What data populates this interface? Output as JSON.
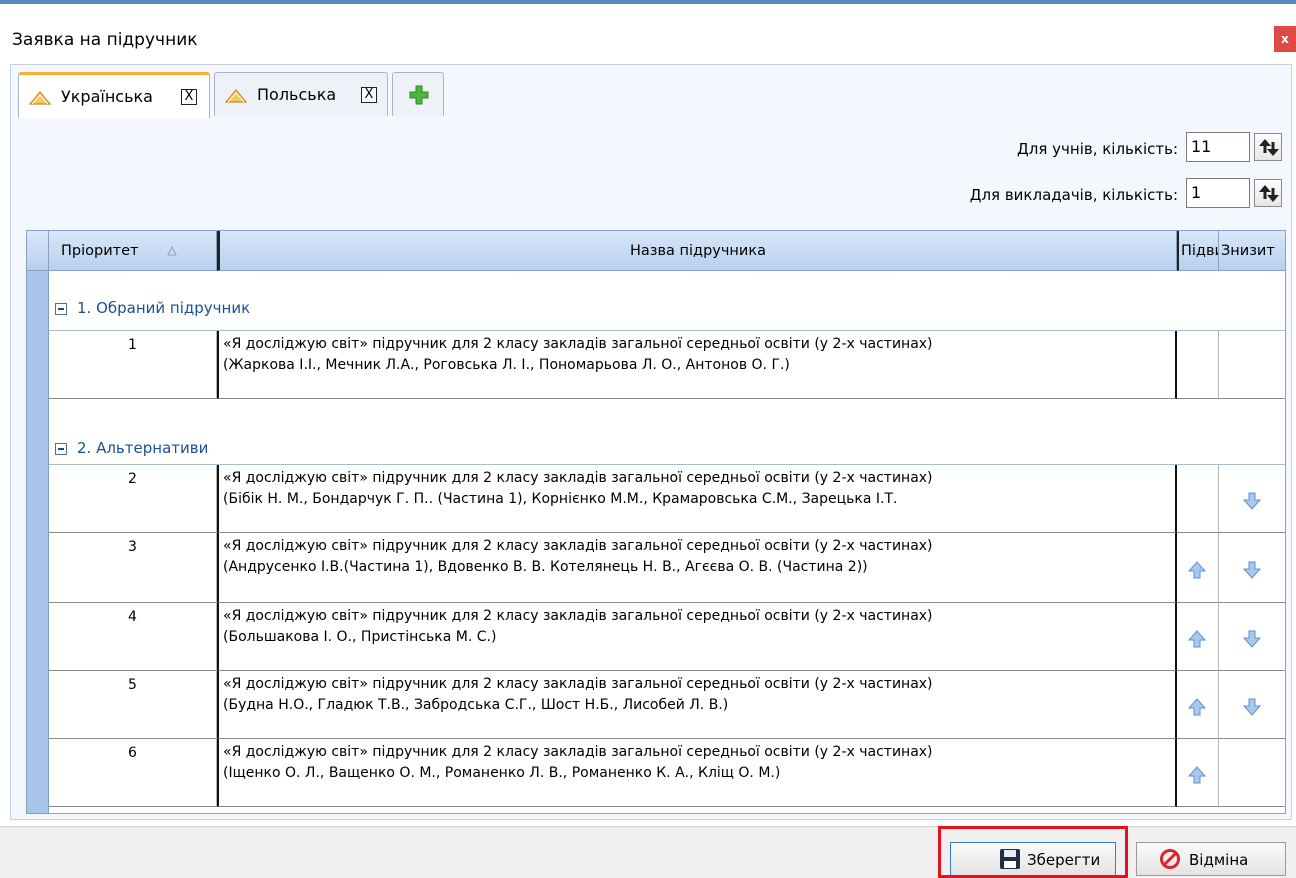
{
  "window": {
    "title": "Заявка на підручник",
    "close_label": "x"
  },
  "tabs": [
    {
      "label": "Українська",
      "close": "X",
      "active": true
    },
    {
      "label": "Польська",
      "close": "X",
      "active": false
    }
  ],
  "quantities": {
    "students_label": "Для учнів, кількість:",
    "students_value": "11",
    "teachers_label": "Для викладачів, кількість:",
    "teachers_value": "1"
  },
  "grid": {
    "columns": {
      "priority": "Пріоритет",
      "name": "Назва підручника",
      "up": "Підвиш",
      "down": "Знизит"
    },
    "groups": {
      "chosen": "1. Обраний підручник",
      "alternatives": "2. Альтернативи"
    },
    "rows": [
      {
        "priority": "1",
        "line1": "«Я досліджую світ» підручник для 2 класу закладів загальної середньої освіти (у 2-х частинах)",
        "line2": "(Жаркова І.І., Мечник Л.А., Роговська Л. І., Пономарьова Л. О., Антонов О. Г.)",
        "up": false,
        "down": false
      },
      {
        "priority": "2",
        "line1": "«Я досліджую світ» підручник для 2 класу закладів загальної середньої освіти (у 2-х частинах)",
        "line2": "(Бібік Н. М., Бондарчук Г. П.. (Частина 1), Корнієнко М.М., Крамаровська С.М., Зарецька І.Т.",
        "up": false,
        "down": true
      },
      {
        "priority": "3",
        "line1": "«Я досліджую світ» підручник для 2 класу закладів загальної середньої освіти (у 2-х частинах)",
        "line2": "(Андрусенко І.В.(Частина 1), Вдовенко В. В. Котелянець Н. В., Агєєва О. В. (Частина 2))",
        "up": true,
        "down": true
      },
      {
        "priority": "4",
        "line1": "«Я досліджую світ» підручник для 2 класу закладів загальної середньої освіти (у 2-х частинах)",
        "line2": "(Большакова І. О., Пристінська М. С.)",
        "up": true,
        "down": true
      },
      {
        "priority": "5",
        "line1": "«Я досліджую світ» підручник для 2 класу закладів загальної середньої освіти (у 2-х частинах)",
        "line2": "(Будна Н.О., Гладюк Т.В., Забродська С.Г., Шост Н.Б., Лисобей Л. В.)",
        "up": true,
        "down": true
      },
      {
        "priority": "6",
        "line1": "«Я досліджую світ» підручник для 2 класу закладів загальної середньої освіти (у 2-х частинах)",
        "line2": "(Іщенко О. Л., Ващенко О. М., Романенко Л. В., Романенко К. А., Кліщ О. М.)",
        "up": true,
        "down": false
      }
    ]
  },
  "buttons": {
    "save": "Зберегти",
    "cancel": "Відміна"
  },
  "colors": {
    "accent_blue": "#a9c6ea",
    "tab_accent": "#f2b233",
    "highlight": "#e8101c",
    "arrow_blue": "#6b9ad6"
  }
}
